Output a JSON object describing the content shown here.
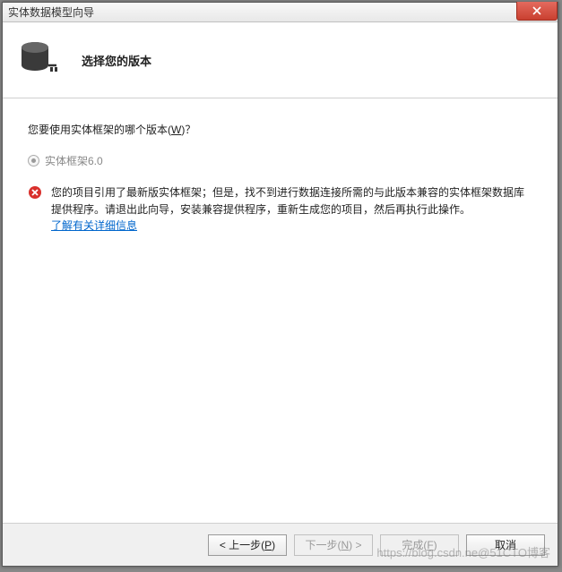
{
  "window": {
    "title": "实体数据模型向导"
  },
  "header": {
    "title": "选择您的版本"
  },
  "content": {
    "question_prefix": "您要使用实体框架的哪个版本(",
    "question_accel": "W",
    "question_suffix": ")？",
    "radio_label": "实体框架6.0",
    "error_text": "您的项目引用了最新版实体框架；但是，找不到进行数据连接所需的与此版本兼容的实体框架数据库提供程序。请退出此向导，安装兼容提供程序，重新生成您的项目，然后再执行此操作。",
    "link_text": "了解有关详细信息"
  },
  "footer": {
    "prev_prefix": "< 上一步(",
    "prev_accel": "P",
    "prev_suffix": ")",
    "next_prefix": "下一步(",
    "next_accel": "N",
    "next_suffix": ") >",
    "finish_prefix": "完成(",
    "finish_accel": "F",
    "finish_suffix": ")",
    "cancel": "取消"
  },
  "watermark": "https://blog.csdn.ne@51CTO博客"
}
